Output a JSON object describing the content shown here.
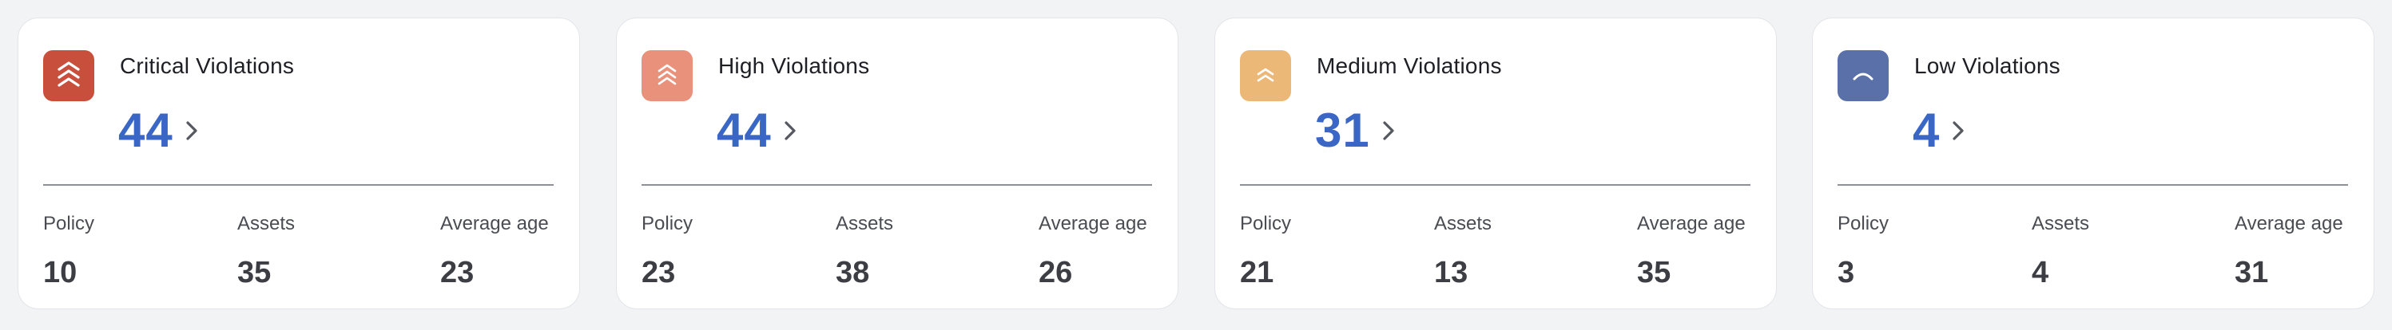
{
  "cards": [
    {
      "title": "Critical Violations",
      "count": "44",
      "severity_color": "#c94f3d",
      "icon": "chevrons-up-triple-icon",
      "stats": {
        "policy_label": "Policy",
        "policy_value": "10",
        "assets_label": "Assets",
        "assets_value": "35",
        "avg_label": "Average age",
        "avg_value": "23"
      }
    },
    {
      "title": "High Violations",
      "count": "44",
      "severity_color": "#e9917a",
      "icon": "chevrons-up-triple-icon",
      "stats": {
        "policy_label": "Policy",
        "policy_value": "23",
        "assets_label": "Assets",
        "assets_value": "38",
        "avg_label": "Average age",
        "avg_value": "26"
      }
    },
    {
      "title": "Medium Violations",
      "count": "31",
      "severity_color": "#ecb877",
      "icon": "chevrons-up-double-icon",
      "stats": {
        "policy_label": "Policy",
        "policy_value": "21",
        "assets_label": "Assets",
        "assets_value": "13",
        "avg_label": "Average age",
        "avg_value": "35"
      }
    },
    {
      "title": "Low Violations",
      "count": "4",
      "severity_color": "#5a70a8",
      "icon": "chevron-up-icon",
      "stats": {
        "policy_label": "Policy",
        "policy_value": "3",
        "assets_label": "Assets",
        "assets_value": "4",
        "avg_label": "Average age",
        "avg_value": "31"
      }
    }
  ],
  "colors": {
    "count_text": "#3a67c5",
    "page_background": "#f2f3f5",
    "card_background": "#ffffff"
  }
}
